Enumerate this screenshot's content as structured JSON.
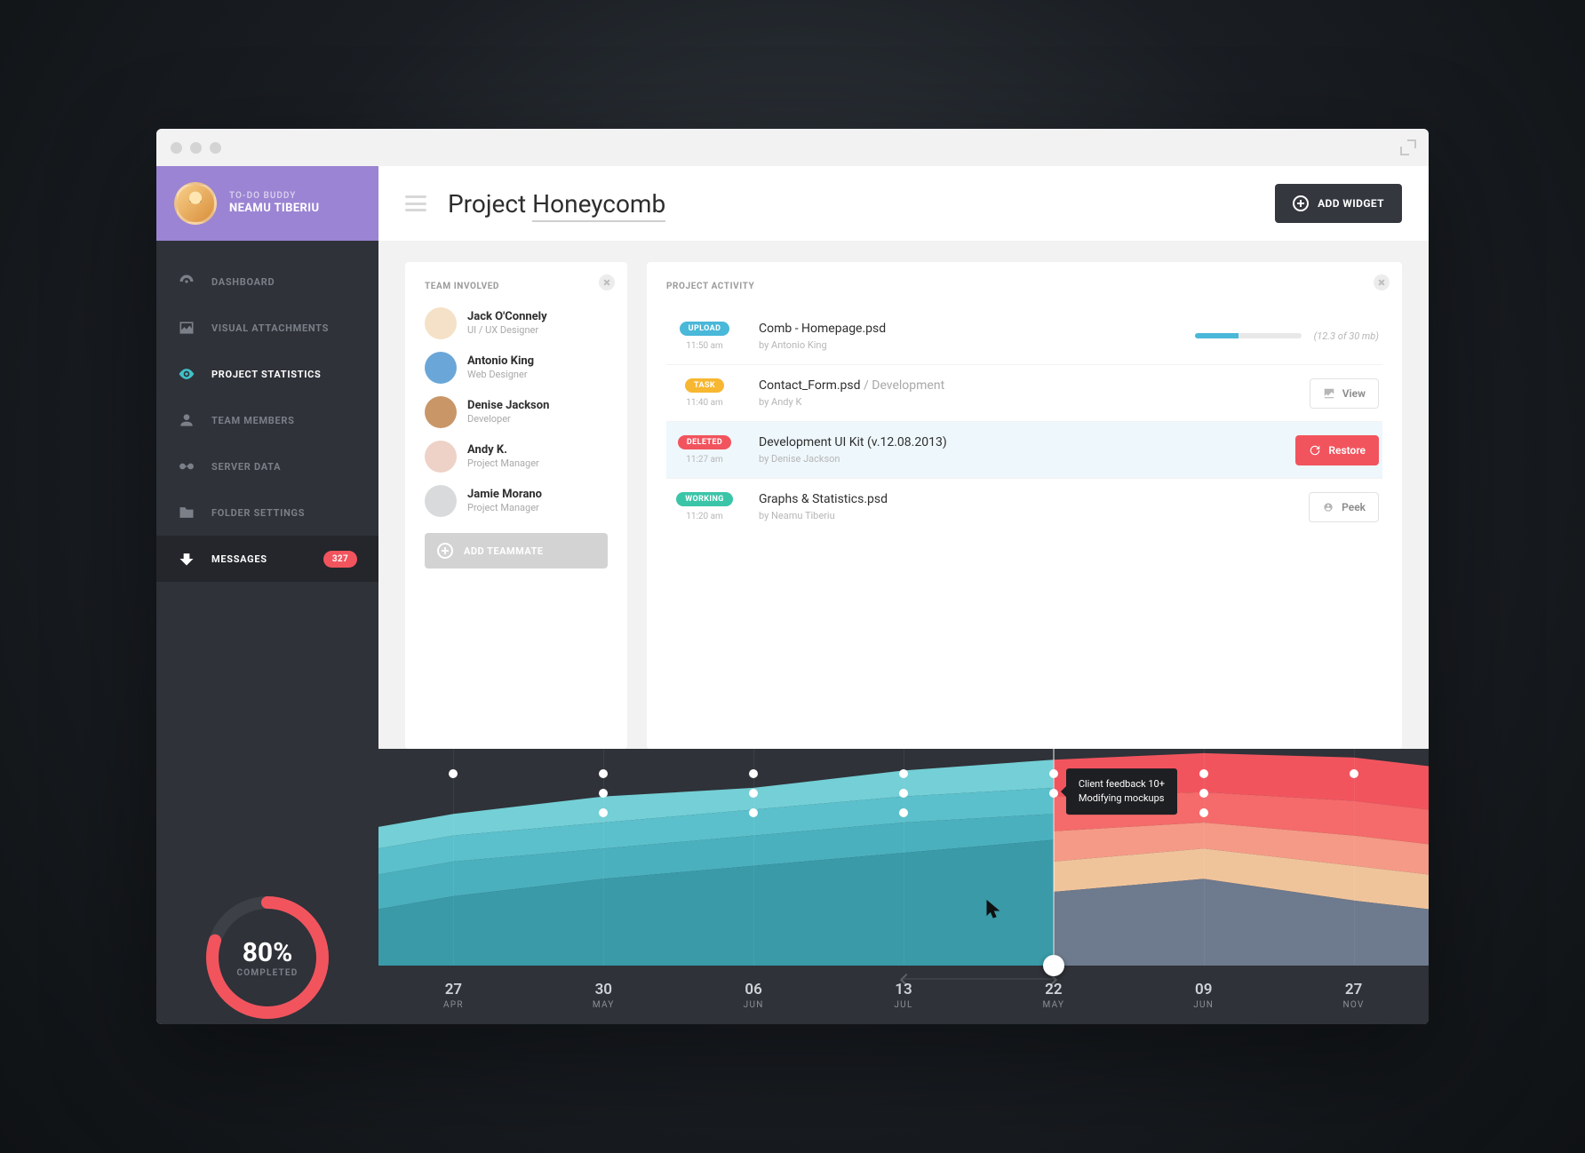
{
  "profile": {
    "app": "TO-DO BUDDY",
    "name": "NEAMU TIBERIU"
  },
  "nav": [
    {
      "label": "DASHBOARD",
      "icon": "dashboard-icon"
    },
    {
      "label": "VISUAL ATTACHMENTS",
      "icon": "image-icon"
    },
    {
      "label": "PROJECT STATISTICS",
      "icon": "eye-icon",
      "active": true
    },
    {
      "label": "TEAM MEMBERS",
      "icon": "user-icon"
    },
    {
      "label": "SERVER DATA",
      "icon": "infinity-icon"
    },
    {
      "label": "FOLDER SETTINGS",
      "icon": "folder-icon"
    },
    {
      "label": "MESSAGES",
      "icon": "inbox-icon",
      "badge": "327",
      "messages": true
    }
  ],
  "progress": {
    "percent": "80%",
    "label": "COMPLETED",
    "value": 80
  },
  "header": {
    "title_pre": "Project ",
    "title_hl": "Honeycomb",
    "add_widget": "ADD WIDGET"
  },
  "team": {
    "title": "TEAM INVOLVED",
    "members": [
      {
        "name": "Jack O'Connely",
        "role": "UI / UX Designer",
        "color": "#f4e1c7"
      },
      {
        "name": "Antonio King",
        "role": "Web Designer",
        "color": "#6aa7d8"
      },
      {
        "name": "Denise Jackson",
        "role": "Developer",
        "color": "#c99668"
      },
      {
        "name": "Andy K.",
        "role": "Project Manager",
        "color": "#eed2c7"
      },
      {
        "name": "Jamie Morano",
        "role": "Project Manager",
        "color": "#d9dadb"
      }
    ],
    "add": "ADD TEAMMATE"
  },
  "activity": {
    "title": "PROJECT ACTIVITY",
    "rows": [
      {
        "tag": "UPLOAD",
        "tag_cls": "upload",
        "time": "11:50 am",
        "title": "Comb - Homepage.psd",
        "by": "by Antonio King",
        "right": "progress",
        "progress": 41,
        "size": "(12.3 of 30 mb)"
      },
      {
        "tag": "TASK",
        "tag_cls": "task",
        "time": "11:40 am",
        "title": "Contact_Form.psd",
        "title_sub": " / Development",
        "by": "by Andy K",
        "right": "view",
        "btn": "View"
      },
      {
        "tag": "DELETED",
        "tag_cls": "deleted",
        "time": "11:27 am",
        "title": "Development UI Kit (v.12.08.2013)",
        "by": "by Denise Jackson",
        "right": "restore",
        "btn": "Restore",
        "row_cls": "deleted"
      },
      {
        "tag": "WORKING",
        "tag_cls": "working",
        "time": "11:20 am",
        "title": "Graphs & Statistics.psd",
        "by": "by Neamu Tiberiu",
        "right": "peek",
        "btn": "Peek"
      }
    ]
  },
  "timeline": {
    "ticks": [
      {
        "day": "27",
        "mon": "APR"
      },
      {
        "day": "30",
        "mon": "MAY"
      },
      {
        "day": "06",
        "mon": "JUN"
      },
      {
        "day": "13",
        "mon": "JUL"
      },
      {
        "day": "22",
        "mon": "MAY"
      },
      {
        "day": "09",
        "mon": "JUN"
      },
      {
        "day": "27",
        "mon": "NOV"
      }
    ],
    "tooltip": {
      "l1": "Client feedback 10+",
      "l2": "Modifying mockups"
    },
    "marker_tick": 4
  },
  "chart_data": {
    "type": "area",
    "note": "Stacked area timeline; left segment (blue palette) before marker, right segment (warm palette) after. Y values are relative heights 0-100 read from chart; dots indicate event markers at each tick.",
    "x_categories": [
      "27 APR",
      "30 MAY",
      "06 JUN",
      "13 JUL",
      "22 MAY",
      "09 JUN",
      "27 NOV"
    ],
    "left_palette": [
      "#3a9aa8",
      "#4bb0bd",
      "#5bc0cb",
      "#74cfd6"
    ],
    "right_palette": [
      "#6e7a8e",
      "#f0c49b",
      "#f59a86",
      "#f56a6a",
      "#f2545e"
    ],
    "series_left": [
      {
        "name": "layer1",
        "values": [
          70,
          78,
          82,
          90,
          95
        ]
      },
      {
        "name": "layer2",
        "values": [
          60,
          66,
          72,
          78,
          82
        ]
      },
      {
        "name": "layer3",
        "values": [
          48,
          54,
          60,
          66,
          70
        ]
      },
      {
        "name": "layer4",
        "values": [
          32,
          40,
          46,
          52,
          58
        ]
      }
    ],
    "series_right": [
      {
        "name": "layer1",
        "values": [
          95,
          98,
          96
        ]
      },
      {
        "name": "layer2",
        "values": [
          78,
          80,
          76
        ]
      },
      {
        "name": "layer3",
        "values": [
          62,
          66,
          60
        ]
      },
      {
        "name": "layer4",
        "values": [
          48,
          54,
          46
        ]
      },
      {
        "name": "layer5",
        "values": [
          34,
          40,
          30
        ]
      }
    ],
    "event_dots": [
      {
        "tick": 0,
        "count": 1
      },
      {
        "tick": 1,
        "count": 3
      },
      {
        "tick": 2,
        "count": 3
      },
      {
        "tick": 3,
        "count": 3
      },
      {
        "tick": 4,
        "count": 2
      },
      {
        "tick": 5,
        "count": 3
      },
      {
        "tick": 6,
        "count": 1
      }
    ]
  }
}
